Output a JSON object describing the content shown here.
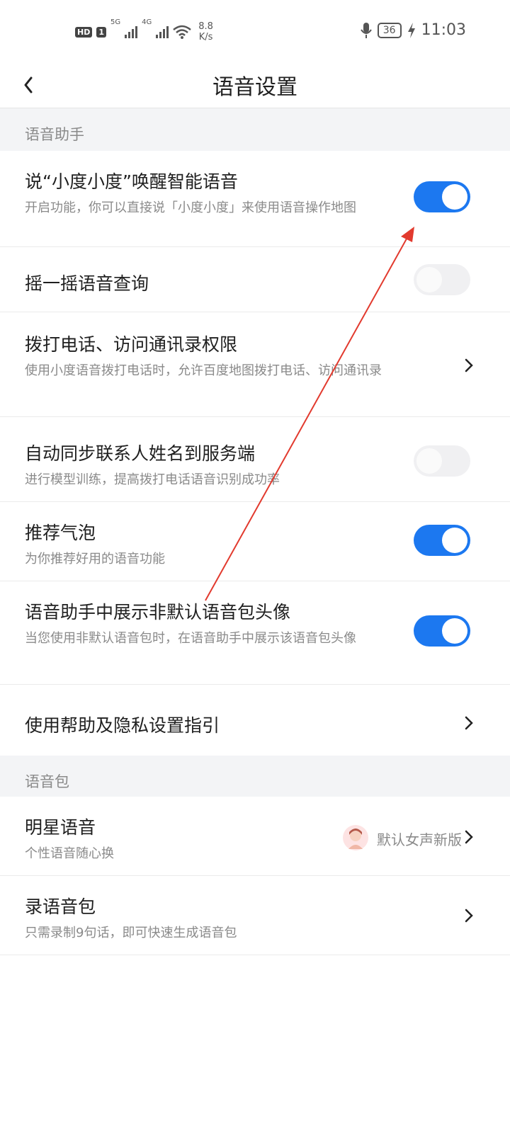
{
  "status": {
    "hd": "HD",
    "sim": "1",
    "net1": "5G",
    "net2": "4G",
    "speed_value": "8.8",
    "speed_unit": "K/s",
    "battery": "36",
    "time": "11:03"
  },
  "header": {
    "title": "语音设置"
  },
  "sections": {
    "assistant": {
      "title": "语音助手"
    },
    "packs": {
      "title": "语音包"
    }
  },
  "settings": {
    "wake": {
      "title": "说“小度小度”唤醒智能语音",
      "desc": "开启功能，你可以直接说「小度小度」来使用语音操作地图",
      "enabled": true
    },
    "shake": {
      "title": "摇一摇语音查询",
      "enabled": false
    },
    "call": {
      "title": "拨打电话、访问通讯录权限",
      "desc": "使用小度语音拨打电话时，允许百度地图拨打电话、访问通讯录"
    },
    "sync": {
      "title": "自动同步联系人姓名到服务端",
      "desc": "进行模型训练，提高拨打电话语音识别成功率",
      "enabled": false
    },
    "bubble": {
      "title": "推荐气泡",
      "desc": "为你推荐好用的语音功能",
      "enabled": true
    },
    "avatar": {
      "title": "语音助手中展示非默认语音包头像",
      "desc": "当您使用非默认语音包时，在语音助手中展示该语音包头像",
      "enabled": true
    },
    "help": {
      "title": "使用帮助及隐私设置指引"
    },
    "star": {
      "title": "明星语音",
      "desc": "个性语音随心换",
      "value": "默认女声新版"
    },
    "record": {
      "title": "录语音包",
      "desc": "只需录制9句话，即可快速生成语音包"
    }
  },
  "colors": {
    "accent": "#1c78f0",
    "annotation": "#e23a2e"
  }
}
